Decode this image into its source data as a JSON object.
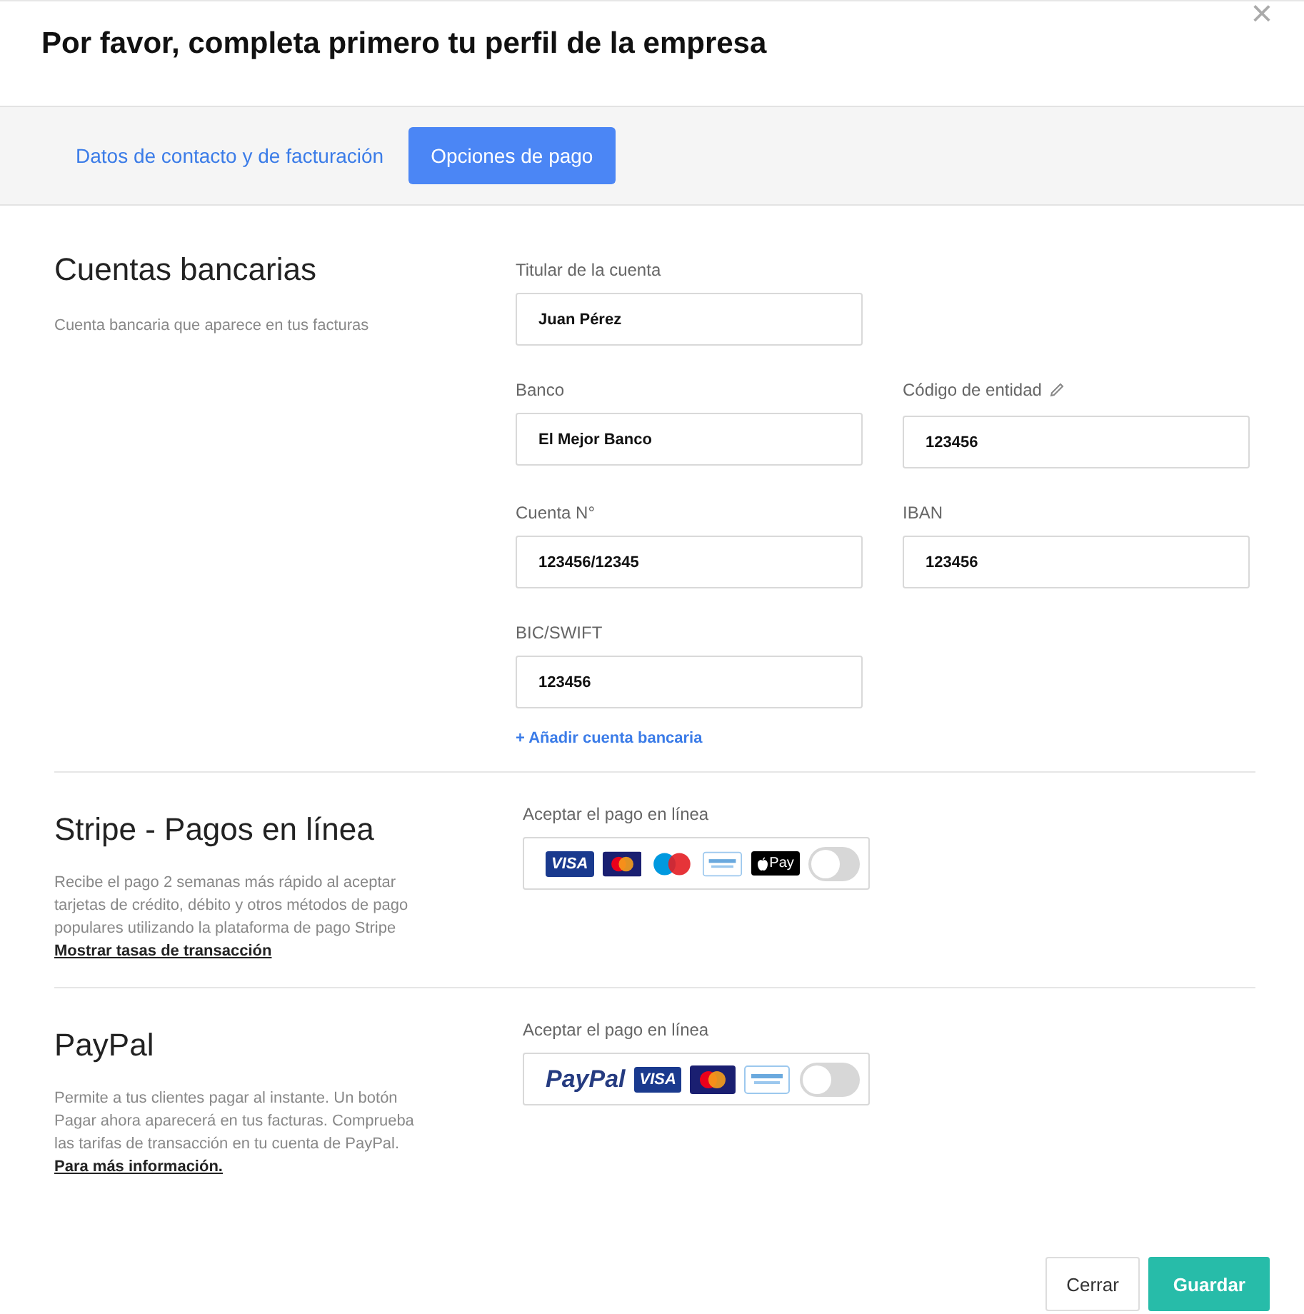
{
  "dialog": {
    "title": "Por favor, completa primero tu perfil de la empresa",
    "close": "×"
  },
  "tabs": [
    {
      "label": "Datos de contacto y de facturación",
      "selected": false
    },
    {
      "label": "Opciones de pago",
      "selected": true
    }
  ],
  "bank": {
    "heading": "Cuentas bancarias",
    "description": "Cuenta bancaria que aparece en tus facturas",
    "fields": [
      {
        "label": "Titular de la cuenta",
        "value": "Juan Pérez",
        "editable_icon": false
      },
      {
        "label": "Banco",
        "value": "El Mejor Banco",
        "editable_icon": false
      },
      {
        "label": "Código de entidad",
        "value": "123456",
        "editable_icon": true
      },
      {
        "label": "Cuenta N°",
        "value": "123456/12345",
        "editable_icon": false
      },
      {
        "label": "IBAN",
        "value": "123456",
        "editable_icon": false
      },
      {
        "label": "BIC/SWIFT",
        "value": "123456",
        "editable_icon": false
      }
    ],
    "add_link": "+ Añadir cuenta bancaria"
  },
  "payments": [
    {
      "heading": "Stripe - Pagos en línea",
      "description": "Recibe el pago 2 semanas más rápido al aceptar tarjetas de crédito, débito y otros métodos de pago populares utilizando la plataforma de pago Stripe",
      "link": "Mostrar tasas de transacción",
      "label": "Aceptar el pago en línea",
      "on": false,
      "logos": [
        {
          "kind": "visa",
          "text": "VISA"
        },
        {
          "kind": "mastercard"
        },
        {
          "kind": "maestro"
        },
        {
          "kind": "amex"
        },
        {
          "kind": "applepay",
          "text": "Pay"
        }
      ]
    },
    {
      "heading": "PayPal",
      "description": "Permite a tus clientes pagar al instante. Un botón Pagar ahora aparecerá en tus facturas. Comprueba las tarifas de transacción en tu cuenta de PayPal.",
      "link": "Para más información.",
      "label": "Aceptar el pago en línea",
      "on": false,
      "logos": [
        {
          "kind": "paypal",
          "text": "PayPal"
        },
        {
          "kind": "visa",
          "text": "VISA"
        },
        {
          "kind": "mastercard"
        },
        {
          "kind": "amex"
        }
      ]
    }
  ],
  "buttons": {
    "close": "Cerrar",
    "save": "Guardar"
  }
}
